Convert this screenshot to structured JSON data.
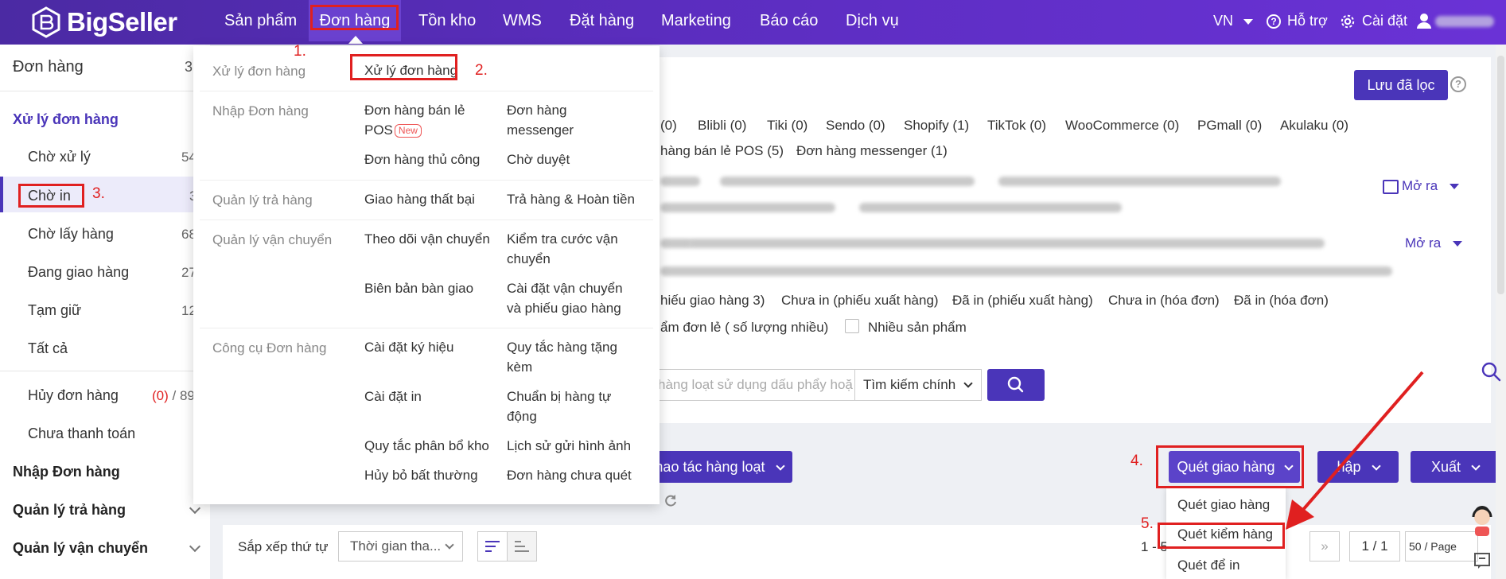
{
  "brand": {
    "name": "BigSeller"
  },
  "nav": {
    "items": [
      "Sản phẩm",
      "Đơn hàng",
      "Tồn kho",
      "WMS",
      "Đặt hàng",
      "Marketing",
      "Báo cáo",
      "Dịch vụ"
    ],
    "lang": "VN",
    "support": "Hỗ trợ",
    "settings": "Cài đặt"
  },
  "sidebar": {
    "title": "Đơn hàng",
    "title_count": "3",
    "section_process": "Xử lý đơn hàng",
    "items": [
      {
        "label": "Chờ xử lý",
        "count": "54"
      },
      {
        "label": "Chờ in",
        "count": "3"
      },
      {
        "label": "Chờ lấy hàng",
        "count": "68"
      },
      {
        "label": "Đang giao hàng",
        "count": "27"
      },
      {
        "label": "Tạm giữ",
        "count": "12"
      },
      {
        "label": "Tất cả",
        "count": ""
      }
    ],
    "cancel": {
      "label": "Hủy đơn hàng",
      "count_a": "(0)",
      "count_b": " / 89"
    },
    "unpaid": "Chưa thanh toán",
    "sections": [
      "Nhập Đơn hàng",
      "Quản lý trả hàng",
      "Quản lý vận chuyển"
    ]
  },
  "mega_menu": {
    "groups": [
      {
        "category": "Xử lý đơn hàng",
        "col1": [
          "Xử lý đơn hàng"
        ],
        "col2": []
      },
      {
        "category": "Nhập Đơn hàng",
        "col1": [
          "Đơn hàng bán lẻ POS",
          "Đơn hàng thủ công"
        ],
        "col2": [
          "Đơn hàng messenger",
          "Chờ duyệt"
        ]
      },
      {
        "category": "Quản lý trả hàng",
        "col1": [
          "Giao hàng thất bại"
        ],
        "col2": [
          "Trả hàng & Hoàn tiền"
        ]
      },
      {
        "category": "Quản lý vận chuyển",
        "col1": [
          "Theo dõi vận chuyển",
          "Biên bản bàn giao"
        ],
        "col2": [
          "Kiểm tra cước vận chuyển",
          "Cài đặt vận chuyển và phiếu giao hàng"
        ]
      },
      {
        "category": "Công cụ Đơn hàng",
        "col1": [
          "Cài đặt ký hiệu",
          "Cài đặt in",
          "Quy tắc phân bổ kho",
          "Hủy bỏ bất thường"
        ],
        "col2": [
          "Quy tắc hàng tặng kèm",
          "Chuẩn bị hàng tự động",
          "Lịch sử gửi hình ảnh",
          "Đơn hàng chưa quét"
        ]
      }
    ],
    "new_tag": "New"
  },
  "filters": {
    "save_filter": "Lưu đã lọc",
    "platforms_row1": [
      "(0)",
      "Blibli (0)",
      "Tiki (0)",
      "Sendo (0)",
      "Shopify (1)",
      "TikTok (0)",
      "WooCommerce (0)",
      "PGmall (0)",
      "Akulaku (0)"
    ],
    "platforms_row2": [
      "hàng bán lẻ POS (5)",
      "Đơn hàng messenger (1)"
    ],
    "expand": "Mở ra",
    "print_status": [
      "hiếu giao hàng 3)",
      "Chưa in (phiếu xuất hàng)",
      "Đã in (phiếu xuất hàng)",
      "Chưa in (hóa đơn)",
      "Đã in (hóa đơn)"
    ],
    "product_type_1": "ẩm đơn lẻ ( số lượng nhiều)",
    "product_type_2": "Nhiều sản phẩm",
    "search_placeholder": "hàng loạt sử dụng dấu phẩy hoặ",
    "search_select": "Tìm kiếm chính"
  },
  "actions": {
    "bulk": "hao tác hàng loạt",
    "scan_ship": "Quét giao hàng",
    "import": "hập",
    "export": "Xuất",
    "dropdown": [
      "Quét giao hàng",
      "Quét kiểm hàng",
      "Quét để in"
    ]
  },
  "sort": {
    "label": "Sắp xếp thứ tự",
    "select": "Thời gian tha..."
  },
  "pager": {
    "range": "1 - 5",
    "page": "1 / 1",
    "page_size": "50 / Page"
  },
  "annotations": [
    "1.",
    "2.",
    "3.",
    "4.",
    "5."
  ],
  "colors": {
    "primary": "#4a35b9",
    "annotation": "#e02020"
  }
}
